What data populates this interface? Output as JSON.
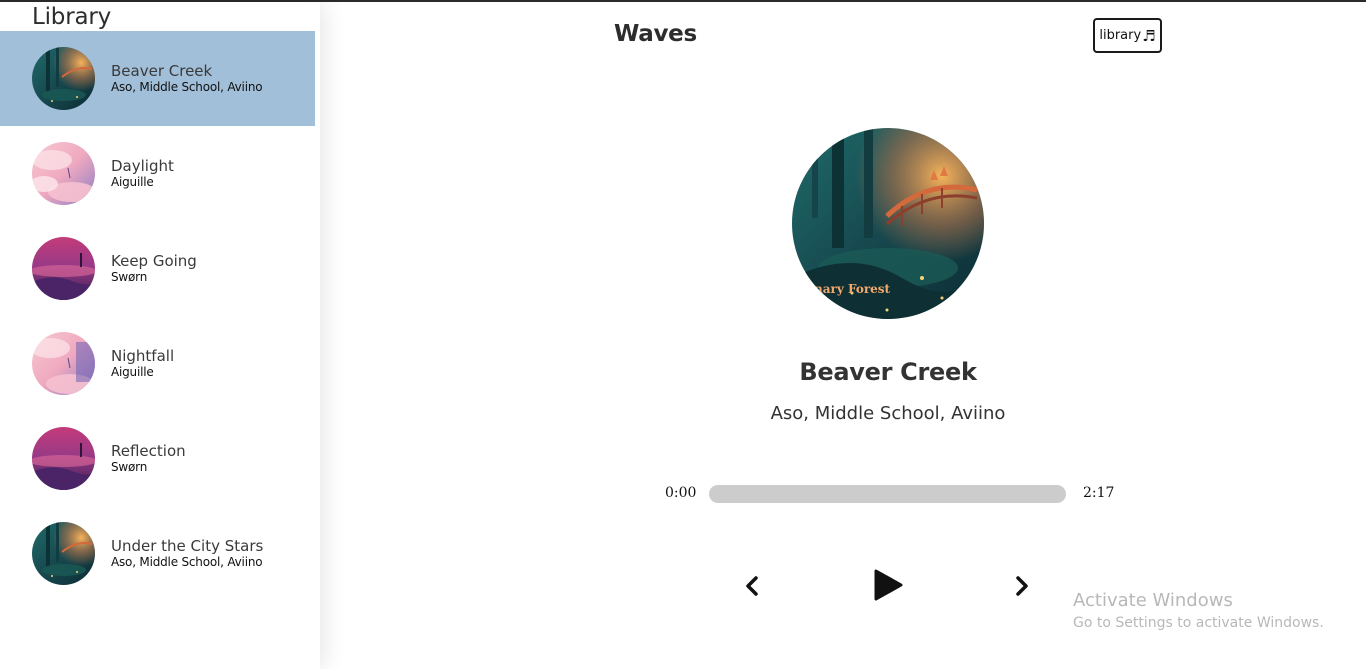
{
  "library": {
    "heading": "Library",
    "songs": [
      {
        "title": "Beaver Creek",
        "artist": "Aso, Middle School, Aviino",
        "cover": "forest-art",
        "active": true
      },
      {
        "title": "Daylight",
        "artist": "Aiguille",
        "cover": "pink-clouds-art",
        "active": false
      },
      {
        "title": "Keep Going",
        "artist": "Swørn",
        "cover": "purple-sunset-art",
        "active": false
      },
      {
        "title": "Nightfall",
        "artist": "Aiguille",
        "cover": "pink-clouds-art",
        "active": false
      },
      {
        "title": "Reflection",
        "artist": "Swørn",
        "cover": "purple-sunset-art",
        "active": false
      },
      {
        "title": "Under the City Stars",
        "artist": "Aso, Middle School, Aviino",
        "cover": "forest-art",
        "active": false
      }
    ]
  },
  "nav": {
    "title": "Waves",
    "library_button": "library",
    "library_icon": "♬"
  },
  "player": {
    "cover_text": "nary Forest",
    "title": "Beaver Creek",
    "artist": "Aso, Middle School, Aviino",
    "current_time": "0:00",
    "duration": "2:17",
    "progress": 0
  },
  "icons": {
    "prev": "chevron-left-icon",
    "play": "play-icon",
    "next": "chevron-right-icon"
  },
  "watermark": {
    "line1": "Activate Windows",
    "line2": "Go to Settings to activate Windows."
  },
  "colors": {
    "active_row": "#a1bfd9",
    "progress_track": "#cccccc"
  }
}
